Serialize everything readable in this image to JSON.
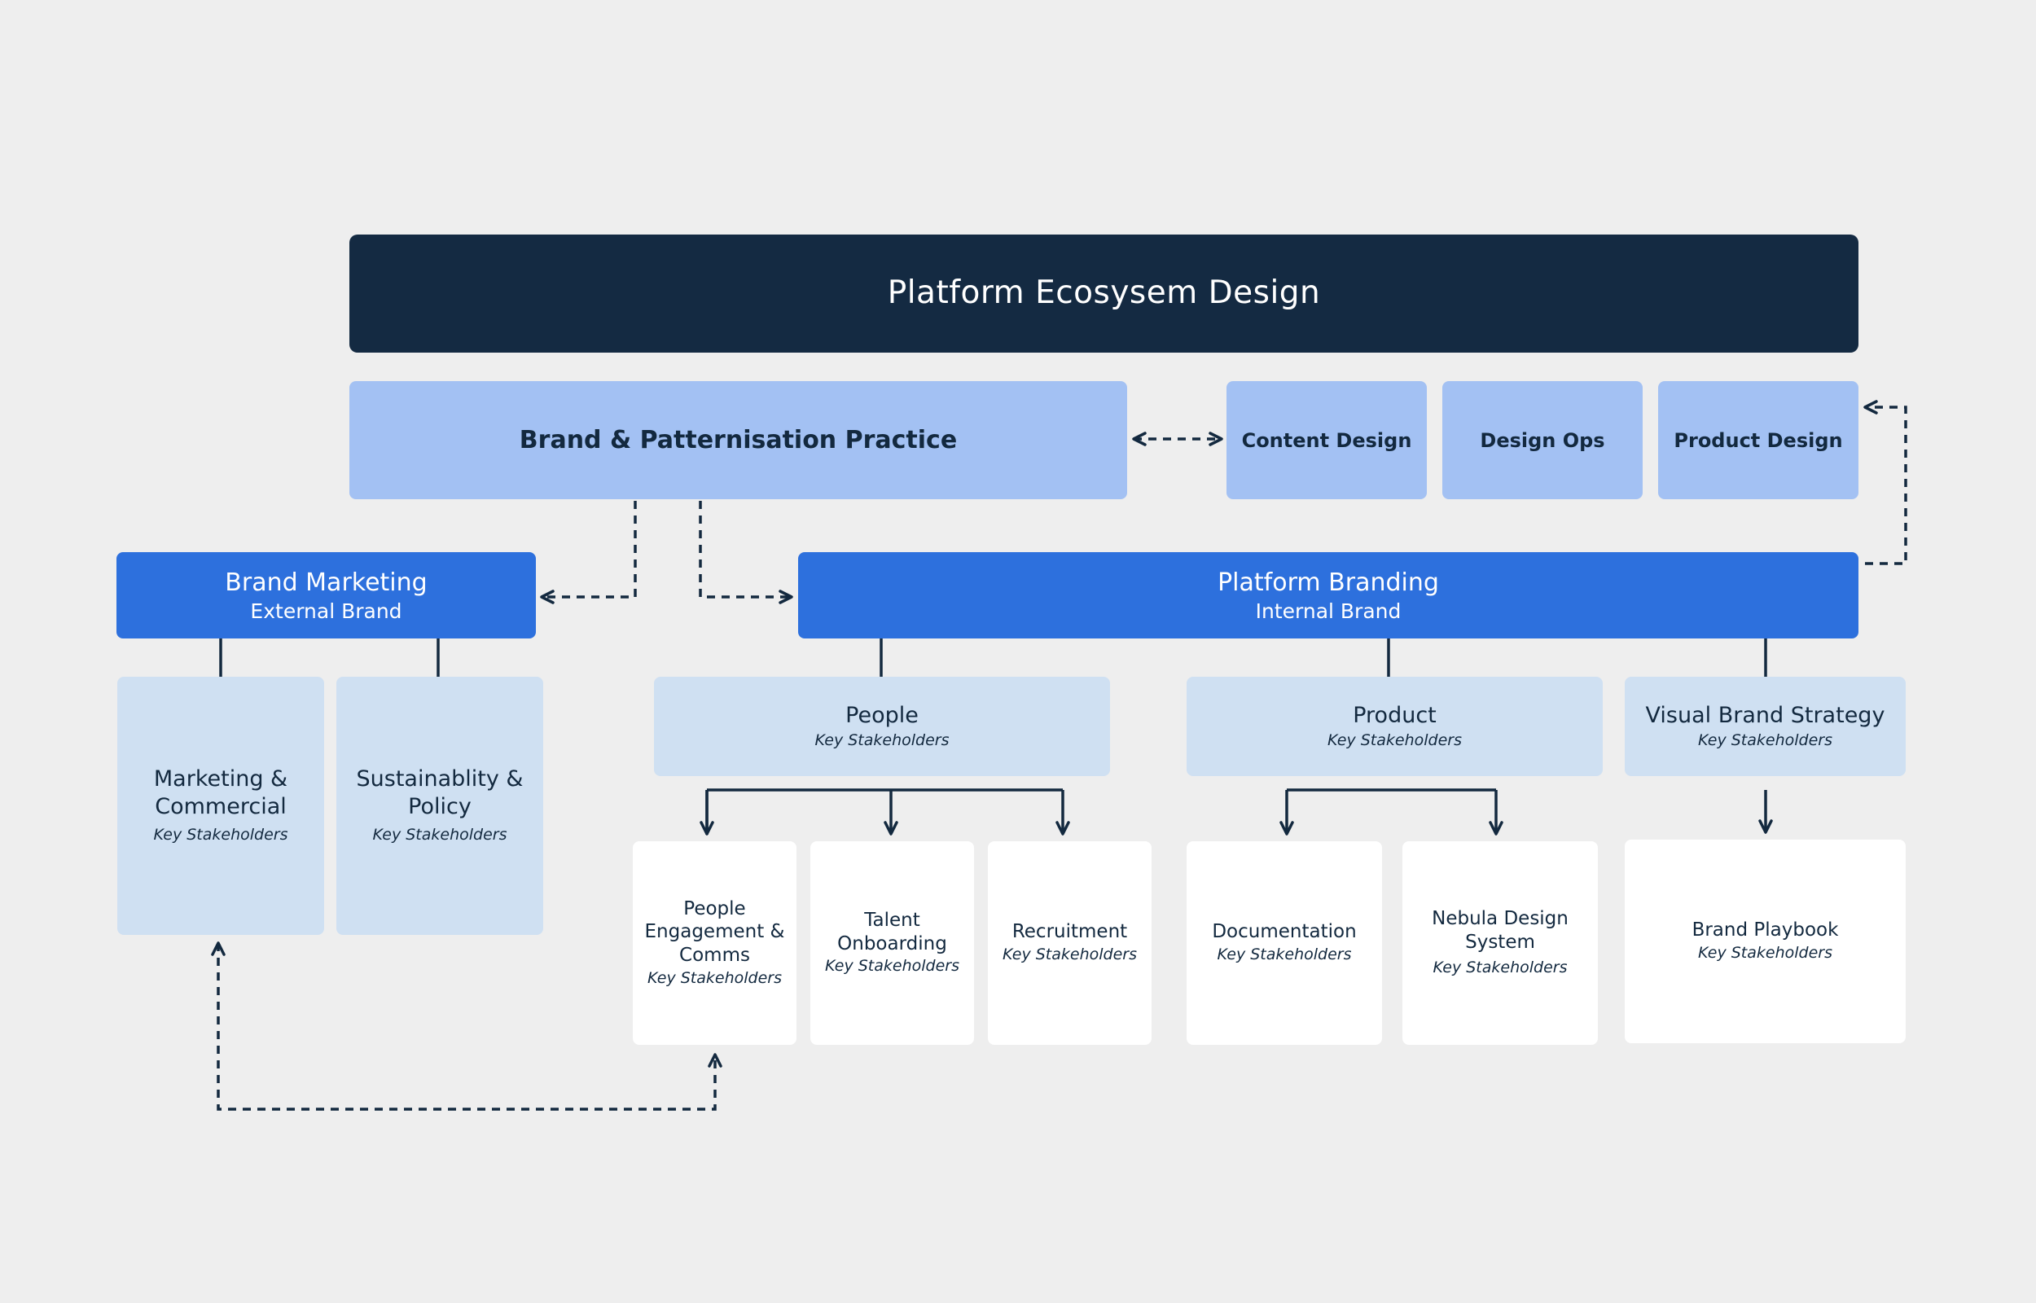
{
  "diagram": {
    "root": {
      "title": "Platform Ecosysem Design"
    },
    "practice": {
      "title": "Brand & Patternisation Practice"
    },
    "peers": [
      {
        "title": "Content Design"
      },
      {
        "title": "Design Ops"
      },
      {
        "title": "Product Design"
      }
    ],
    "brand_marketing": {
      "title": "Brand Marketing",
      "subtitle": "External Brand"
    },
    "platform_branding": {
      "title": "Platform Branding",
      "subtitle": "Internal Brand"
    },
    "marketing_groups": [
      {
        "title": "Marketing & Commercial",
        "subtitle": "Key Stakeholders"
      },
      {
        "title": "Sustainablity & Policy",
        "subtitle": "Key Stakeholders"
      }
    ],
    "platform_groups": [
      {
        "title": "People",
        "subtitle": "Key Stakeholders"
      },
      {
        "title": "Product",
        "subtitle": "Key Stakeholders"
      },
      {
        "title": "Visual Brand Strategy",
        "subtitle": "Key Stakeholders"
      }
    ],
    "leaves": [
      {
        "title": "People Engagement & Comms",
        "subtitle": "Key Stakeholders"
      },
      {
        "title": "Talent Onboarding",
        "subtitle": "Key Stakeholders"
      },
      {
        "title": "Recruitment",
        "subtitle": "Key Stakeholders"
      },
      {
        "title": "Documentation",
        "subtitle": "Key Stakeholders"
      },
      {
        "title": "Nebula Design System",
        "subtitle": "Key Stakeholders"
      },
      {
        "title": "Brand Playbook",
        "subtitle": "Key Stakeholders"
      }
    ]
  },
  "colors": {
    "background": "#eeeeee",
    "root": "#142a42",
    "practice": "#a3c1f3",
    "division": "#2d70dd",
    "group": "#cfe0f2",
    "leaf": "#ffffff",
    "connector": "#13293f"
  }
}
